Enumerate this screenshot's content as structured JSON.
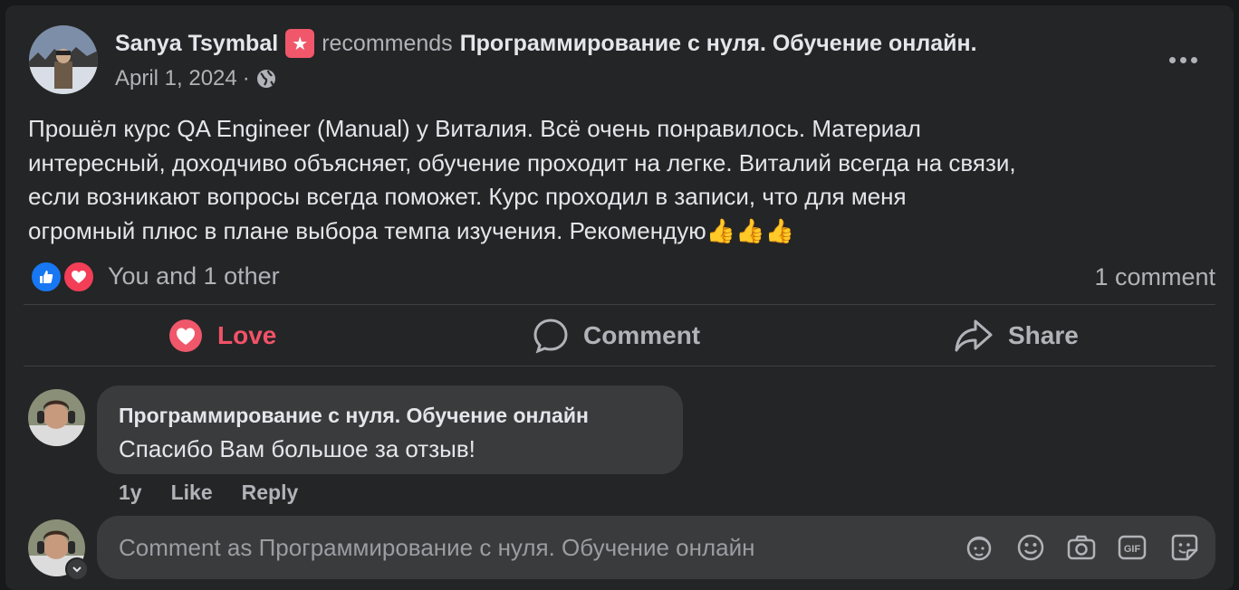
{
  "post": {
    "author": "Sanya Tsymbal",
    "recommends_word": "recommends",
    "page_name": "Программирование с нуля. Обучение онлайн",
    "page_name_suffix": ".",
    "date": "April 1, 2024",
    "date_sep": "·",
    "text": "Прошёл курс QA Engineer (Manual) у Виталия. Всё очень понравилось. Материал\nинтересный, доходчиво объясняет, обучение проходит на легке. Виталий всегда на связи,\nесли возникают вопросы всегда поможет. Курс проходил в записи, что для меня\nогромный плюс в плане выбора темпа изучения. Рекомендую👍👍👍",
    "options_icon": "more-dots-icon",
    "recommend_icon": "recommend-star-icon",
    "audience_icon": "globe-icon"
  },
  "reactions": {
    "summary": "You and 1 other",
    "comments_count": "1 comment",
    "icons": [
      "like-icon",
      "love-icon"
    ]
  },
  "actions": {
    "love_label": "Love",
    "comment_label": "Comment",
    "share_label": "Share",
    "love_color": "#f25268"
  },
  "comment": {
    "author": "Программирование с нуля. Обучение онлайн",
    "text": "Спасибо Вам большое за отзыв!",
    "age": "1y",
    "like_label": "Like",
    "reply_label": "Reply"
  },
  "composer": {
    "placeholder": "Comment as Программирование с нуля. Обучение онлайн",
    "tools": [
      "avatar-sticker-icon",
      "emoji-icon",
      "camera-icon",
      "gif-icon",
      "sticker-icon"
    ]
  },
  "colors": {
    "background": "#242526",
    "bubble": "#3a3b3c",
    "text_primary": "#e4e6eb",
    "text_secondary": "#b0b3b8",
    "like_blue": "#1877f2",
    "love_red": "#f0576b"
  }
}
